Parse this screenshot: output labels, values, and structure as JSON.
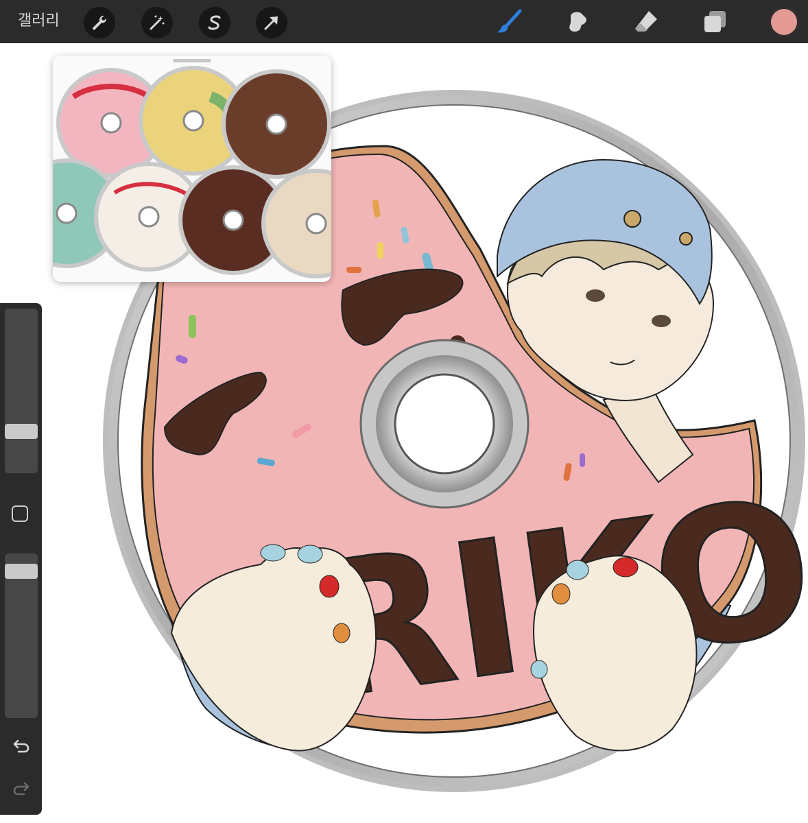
{
  "toolbar": {
    "gallery_label": "갤러리",
    "left_tools": [
      "wrench-icon",
      "magic-wand-icon",
      "selection-s-icon",
      "move-arrow-icon"
    ],
    "right_tools": [
      "brush-icon",
      "smudge-icon",
      "eraser-icon",
      "layers-icon"
    ],
    "active_tool": "brush-icon",
    "active_color": "#e39a95",
    "accent_color": "#2f7fe0"
  },
  "sidebar": {
    "brush_size_level": 0.78,
    "opacity_level": 0.05,
    "controls": [
      "brush-size-slider",
      "modify-button",
      "opacity-slider",
      "undo-icon",
      "redo-icon"
    ]
  },
  "canvas": {
    "artwork_text": "RIKO",
    "frosting_color": "#f2b5b5",
    "chocolate_color": "#4a2a1f",
    "disc_rim_color": "#bdbdbd"
  },
  "reference_window": {
    "disc_count": 7
  }
}
